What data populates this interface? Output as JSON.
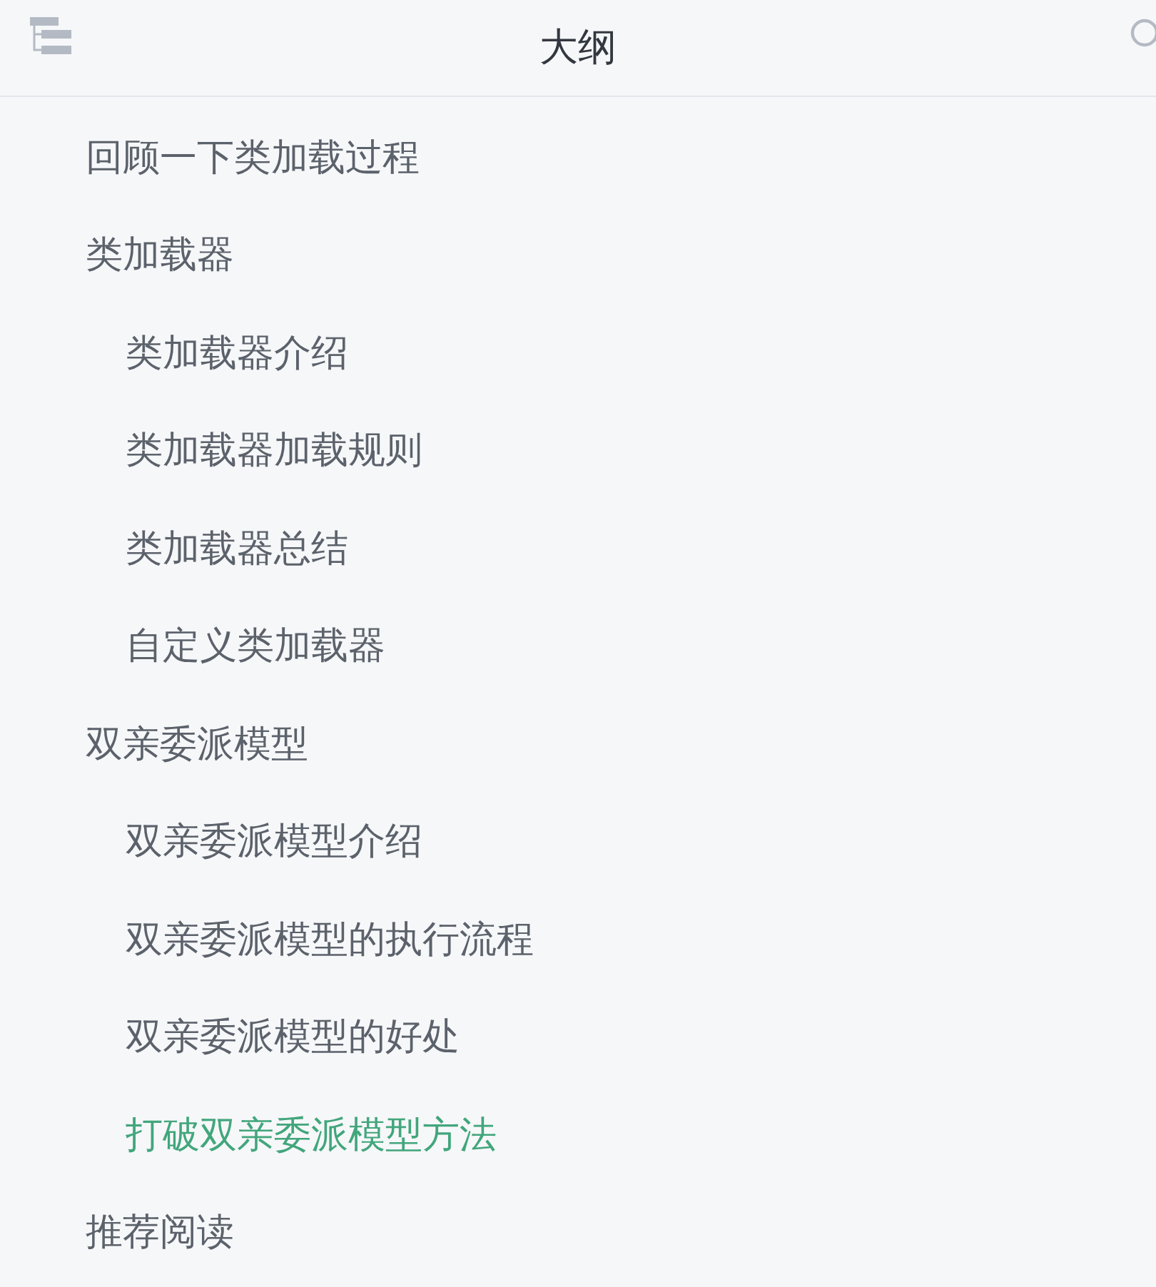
{
  "header": {
    "title": "大纲"
  },
  "outline": [
    {
      "label": "回顾一下类加载过程",
      "selected": false
    },
    {
      "label": "类加载器",
      "selected": false,
      "children": [
        {
          "label": "类加载器介绍",
          "selected": false
        },
        {
          "label": "类加载器加载规则",
          "selected": false
        },
        {
          "label": "类加载器总结",
          "selected": false
        },
        {
          "label": "自定义类加载器",
          "selected": false
        }
      ]
    },
    {
      "label": "双亲委派模型",
      "selected": false,
      "children": [
        {
          "label": "双亲委派模型介绍",
          "selected": false
        },
        {
          "label": "双亲委派模型的执行流程",
          "selected": false
        },
        {
          "label": "双亲委派模型的好处",
          "selected": false
        },
        {
          "label": "打破双亲委派模型方法",
          "selected": true
        }
      ]
    },
    {
      "label": "推荐阅读",
      "selected": false
    }
  ]
}
